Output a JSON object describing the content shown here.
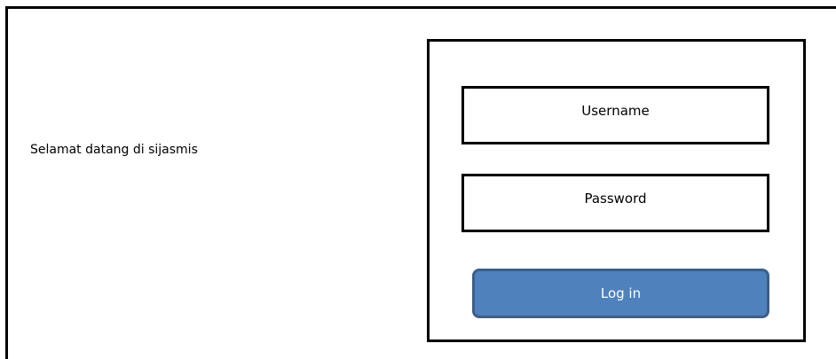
{
  "welcome_text": "Selamat datang di sijasmis",
  "login": {
    "username_placeholder": "Username",
    "password_placeholder": "Password",
    "button_label": "Log in",
    "button_color": "#4f81bd",
    "button_border_color": "#3d5f87"
  }
}
